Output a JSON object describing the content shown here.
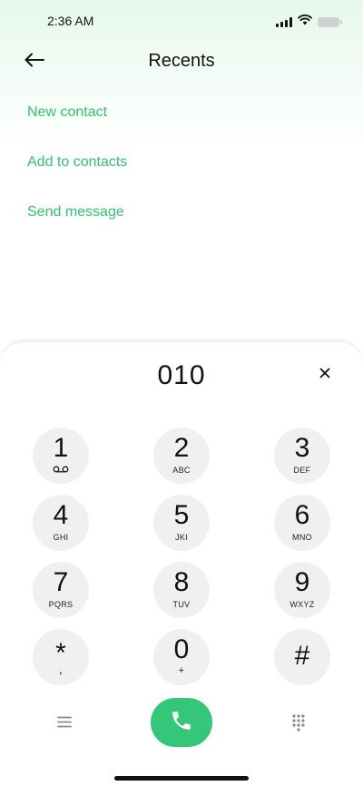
{
  "status_bar": {
    "time": "2:36 AM"
  },
  "header": {
    "title": "Recents"
  },
  "actions": [
    {
      "label": "New contact"
    },
    {
      "label": "Add to contacts"
    },
    {
      "label": "Send message"
    }
  ],
  "dialer": {
    "number": "010",
    "keys": [
      {
        "digit": "1",
        "letters": "",
        "sub_icon": "voicemail-icon"
      },
      {
        "digit": "2",
        "letters": "ABC"
      },
      {
        "digit": "3",
        "letters": "DEF"
      },
      {
        "digit": "4",
        "letters": "GHI"
      },
      {
        "digit": "5",
        "letters": "JKI"
      },
      {
        "digit": "6",
        "letters": "MNO"
      },
      {
        "digit": "7",
        "letters": "PQRS"
      },
      {
        "digit": "8",
        "letters": "TUV"
      },
      {
        "digit": "9",
        "letters": "WXYZ"
      },
      {
        "digit": "*",
        "letters": ","
      },
      {
        "digit": "0",
        "letters": "+"
      },
      {
        "digit": "#",
        "letters": ""
      }
    ]
  },
  "icons": {
    "back": "arrow-left-icon",
    "clear": "close-icon",
    "menu": "hamburger-icon",
    "call": "phone-icon",
    "keypad": "dialpad-icon"
  },
  "colors": {
    "accent": "#2fc56f",
    "call_button": "#34c77a",
    "key_background": "#f0f0f0"
  }
}
